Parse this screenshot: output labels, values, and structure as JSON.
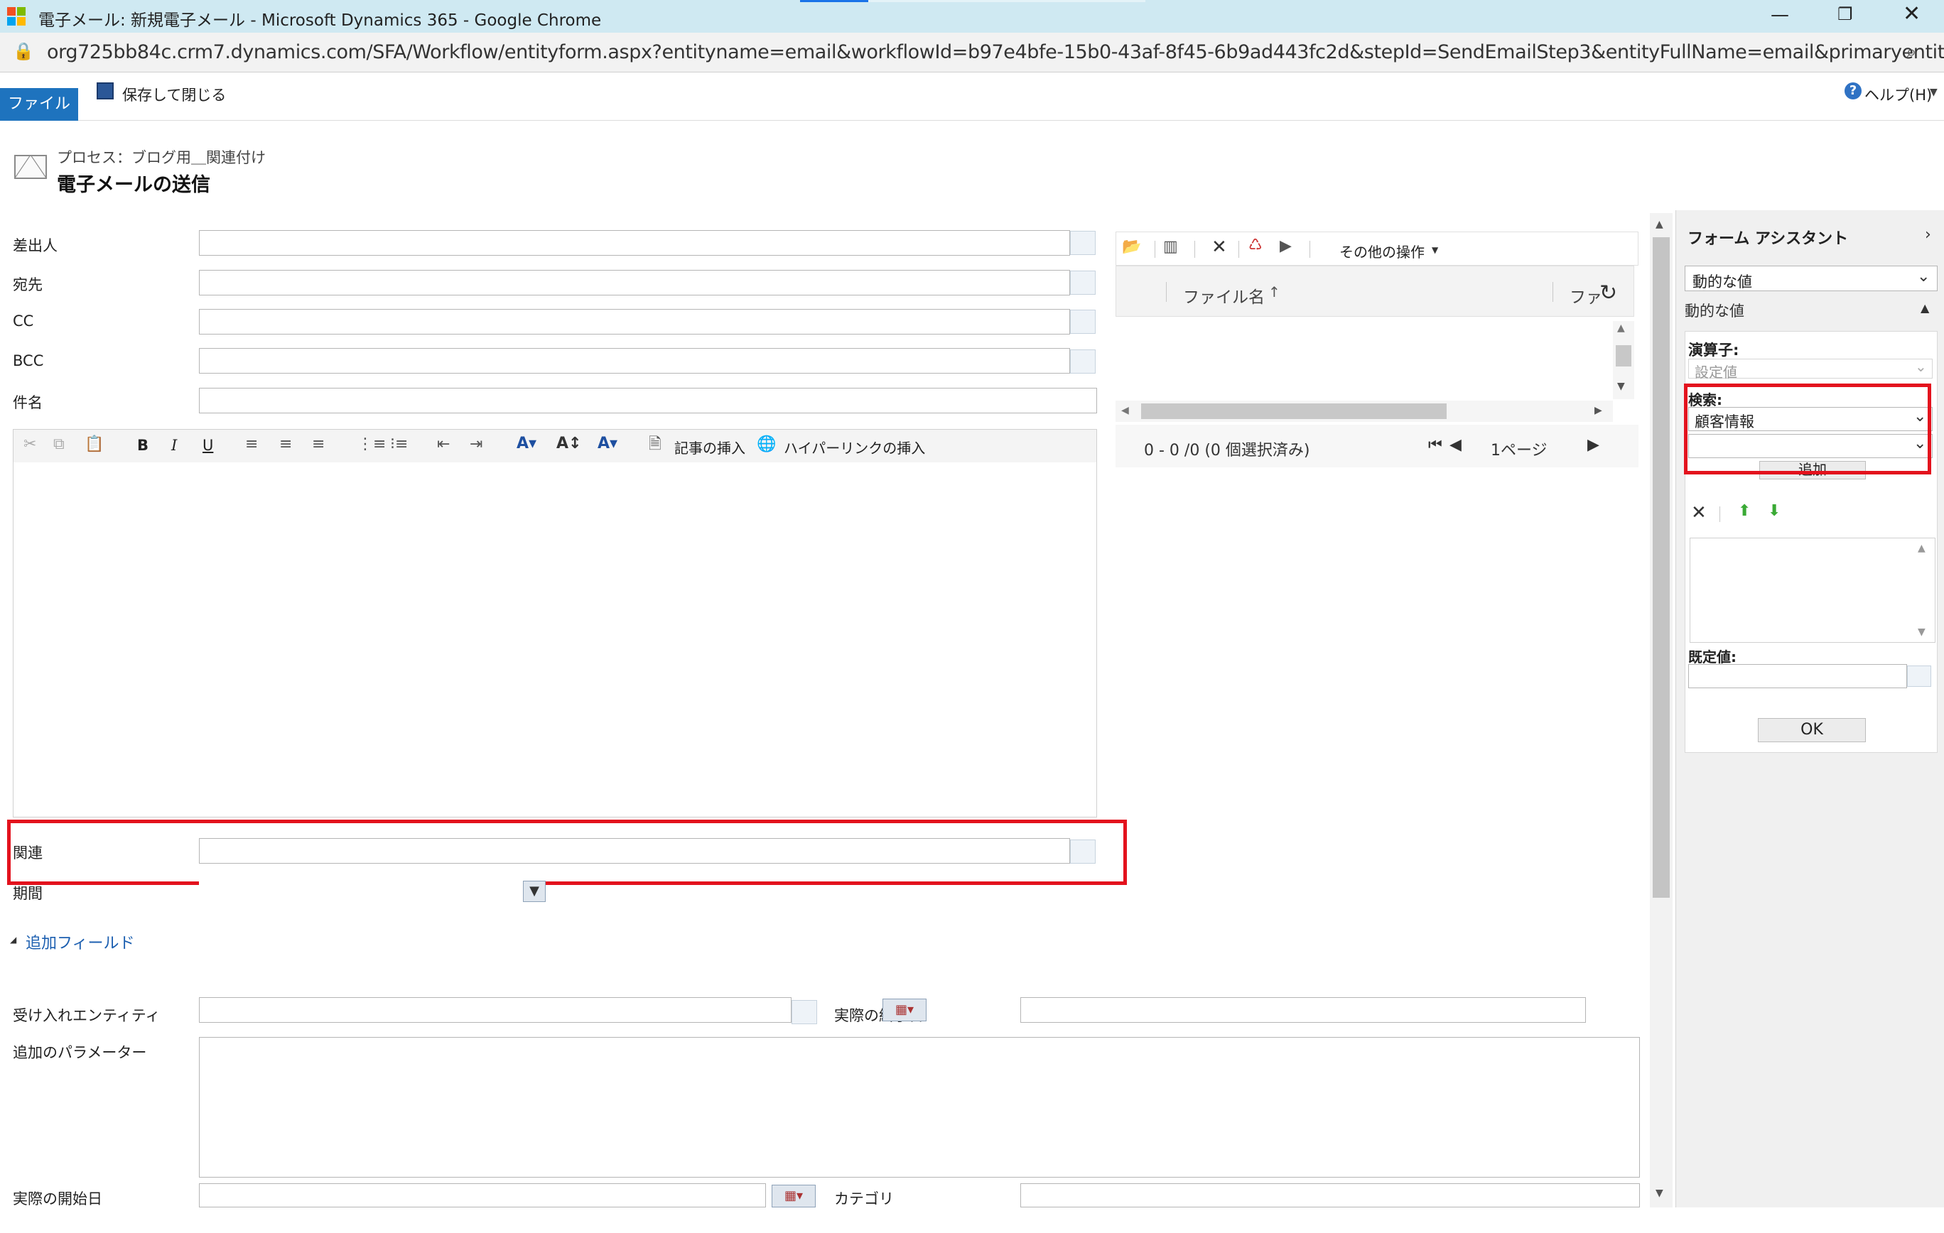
{
  "window": {
    "title": "電子メール: 新規電子メール - Microsoft Dynamics 365 - Google Chrome",
    "url": "org725bb84c.crm7.dynamics.com/SFA/Workflow/entityform.aspx?entityname=email&workflowId=b97e4bfe-15b0-43af-8f45-6b9ad443fc2d&stepId=SendEmailStep3&entityFullName=email&primaryentity=ne..."
  },
  "ribbon": {
    "file_tab": "ファイル",
    "save_close": "保存して閉じる",
    "help": "ヘルプ(H)"
  },
  "header": {
    "process": "プロセス：ブログ用＿関連付け",
    "title": "電子メールの送信"
  },
  "form": {
    "from_label": "差出人",
    "to_label": "宛先",
    "cc_label": "CC",
    "bcc_label": "BCC",
    "subject_label": "件名",
    "regarding_label": "関連",
    "duration_label": "期間",
    "additional_fields": "追加フィールド",
    "receiving_entity_label": "受け入れエンティティ",
    "actual_end_label": "実際の終了日",
    "additional_params_label": "追加のパラメーター",
    "actual_start_label": "実際の開始日",
    "category_label": "カテゴリ"
  },
  "editor": {
    "insert_article": "記事の挿入",
    "insert_hyperlink": "ハイパーリンクの挿入"
  },
  "attachments": {
    "more_actions": "その他の操作",
    "col_filename": "ファイル名",
    "col_second": "ファ",
    "status": "0 - 0 /0 (0 個選択済み)",
    "page": "1ページ"
  },
  "assistant": {
    "title": "フォーム アシスタント",
    "dropdown_value": "動的な値",
    "section_label": "動的な値",
    "operator_label": "演算子:",
    "operator_value": "設定値",
    "search_label": "検索:",
    "search_value": "顧客情報",
    "add_button": "追加",
    "default_label": "既定値:",
    "ok_button": "OK"
  }
}
